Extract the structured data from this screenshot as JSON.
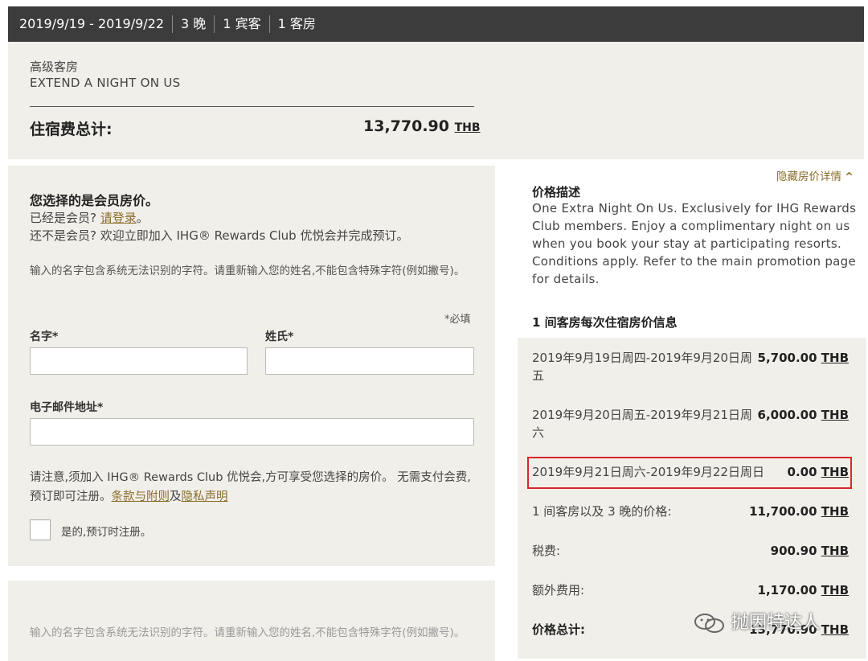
{
  "topbar": {
    "dates": "2019/9/19 - 2019/9/22",
    "nights": "3 晚",
    "guests": "1 宾客",
    "rooms": "1 客房"
  },
  "summary": {
    "room_type": "高级客房",
    "rate_name": "EXTEND A NIGHT ON US",
    "total_label": "住宿费总计:",
    "total_amount": "13,770.90",
    "currency": "THB"
  },
  "member_form": {
    "title": "您选择的是会员房价。",
    "already_member": "已经是会员?",
    "login_link": "请登录",
    "login_suffix": "。",
    "not_member": "还不是会员? 欢迎立即加入 IHG® Rewards Club 优悦会并完成预订。",
    "name_notice": "输入的名字包含系统无法识别的字符。请重新输入您的姓名,不能包含特殊字符(例如撇号)。",
    "required_note": "*必填",
    "first_name_label": "名字*",
    "last_name_label": "姓氏*",
    "email_label": "电子邮件地址*",
    "first_name_value": "",
    "last_name_value": "",
    "email_value": "",
    "join_notice": "请注意,须加入 IHG® Rewards Club 优悦会,方可享受您选择的房价。 无需支付会费,预订即可注册。",
    "terms_link": "条款与附则",
    "and_text": "及",
    "privacy_link": "隐私声明",
    "checkbox_label": "是的,预订时注册。"
  },
  "second_panel": {
    "name_notice": "输入的名字包含系统无法识别的字符。请重新输入您的姓名,不能包含特殊字符(例如撇号)。"
  },
  "price_details": {
    "hide_link": "隐藏房价详情",
    "desc_title": "价格描述",
    "desc_text": "One Extra Night On Us. Exclusively for IHG Rewards Club members. Enjoy a complimentary night on us when you book your stay at participating resorts. Conditions apply. Refer to the main promotion page for details.",
    "per_night_title": "1 间客房每次住宿房价信息",
    "currency": "THB",
    "nights": [
      {
        "label": "2019年9月19日周四-2019年9月20日周五",
        "amount": "5,700.00"
      },
      {
        "label": "2019年9月20日周五-2019年9月21日周六",
        "amount": "6,000.00"
      },
      {
        "label": "2019年9月21日周六-2019年9月22日周日",
        "amount": "0.00"
      }
    ],
    "subtotal_label": "1 间客房以及 3 晚的价格:",
    "subtotal_amount": "11,700.00",
    "tax_label": "税费:",
    "tax_amount": "900.90",
    "fees_label": "额外费用:",
    "fees_amount": "1,170.00",
    "grand_label": "价格总计:",
    "grand_amount": "13,770.90"
  },
  "watermark": {
    "text": "抛因特达人",
    "icon": "wechat-icon"
  },
  "colors": {
    "topbar_bg": "#3c3c3c",
    "panel_bg": "#f1efe9",
    "link_gold": "#8a6d2a",
    "highlight_red": "#d9262a"
  }
}
